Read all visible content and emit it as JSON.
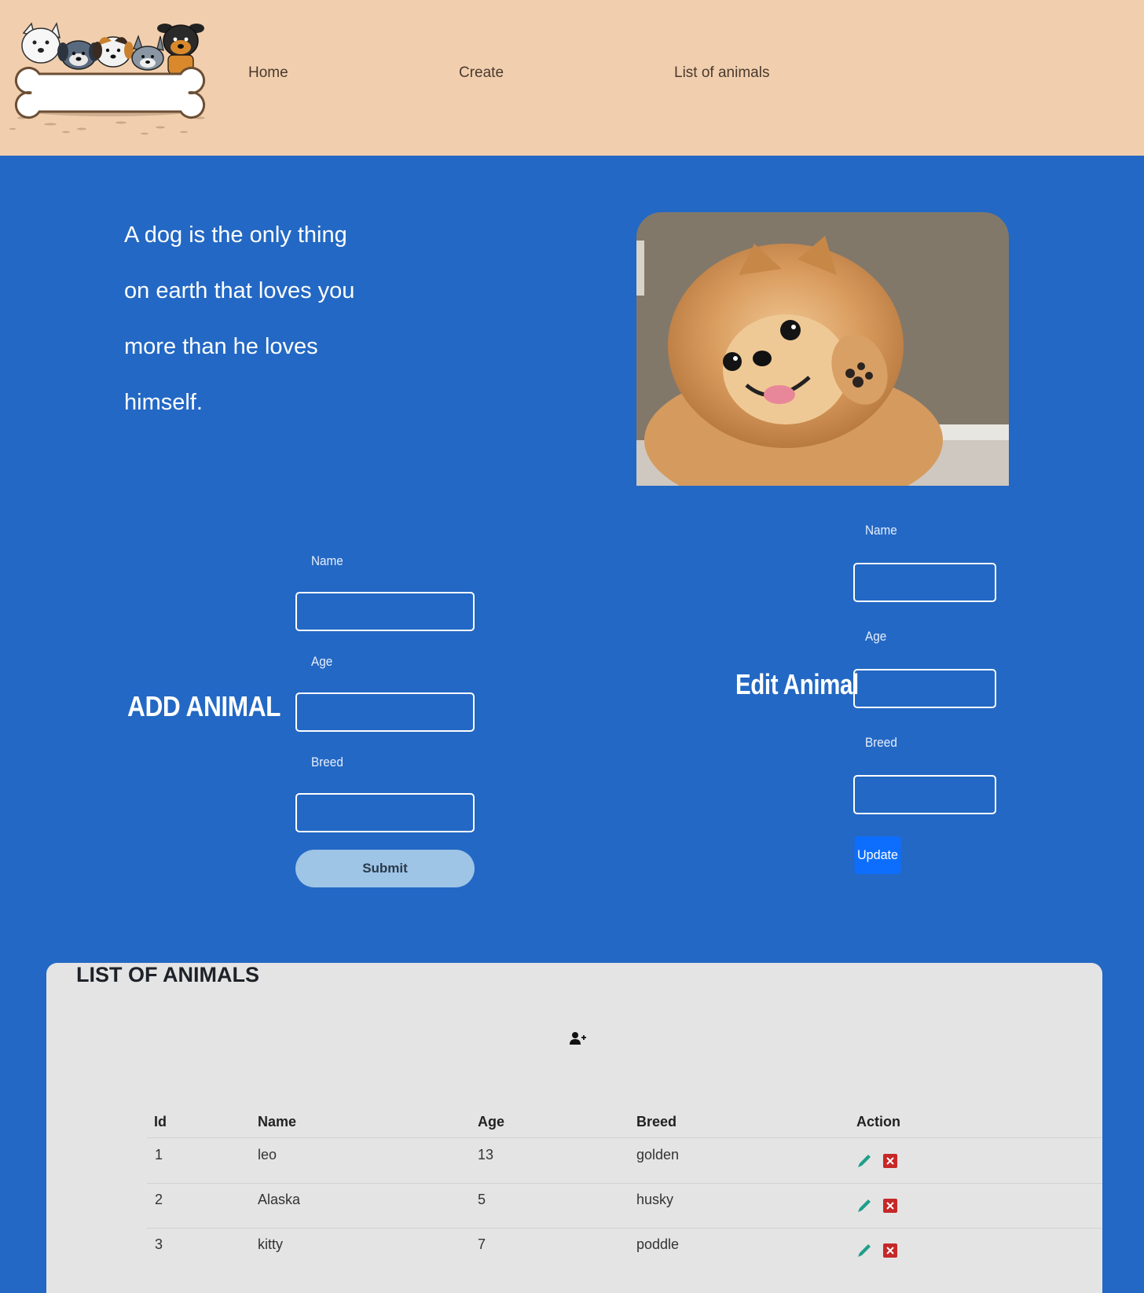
{
  "nav": {
    "links": [
      "Home",
      "Create",
      "List of animals"
    ]
  },
  "hero": {
    "quote_lines": [
      "A dog is the only thing",
      "on earth that loves you",
      "more than he loves",
      "himself."
    ]
  },
  "add_form": {
    "title": "ADD ANIMAL",
    "name_label": "Name",
    "age_label": "Age",
    "breed_label": "Breed",
    "name_value": "",
    "age_value": "",
    "breed_value": "",
    "submit_label": "Submit"
  },
  "edit_form": {
    "title": "Edit Animal",
    "name_label": "Name",
    "age_label": "Age",
    "breed_label": "Breed",
    "name_value": "",
    "age_value": "",
    "breed_value": "",
    "update_label": "Update"
  },
  "list": {
    "title": "LIST OF ANIMALS",
    "add_icon": "add-user-icon",
    "columns": [
      "Id",
      "Name",
      "Age",
      "Breed",
      "Action"
    ],
    "rows": [
      {
        "id": "1",
        "name": "leo",
        "age": "13",
        "breed": "golden"
      },
      {
        "id": "2",
        "name": "Alaska",
        "age": "5",
        "breed": "husky"
      },
      {
        "id": "3",
        "name": "kitty",
        "age": "7",
        "breed": "poddle"
      }
    ],
    "action_icons": [
      "pencil-icon",
      "delete-x-icon"
    ]
  },
  "colors": {
    "header_bg": "#f1cfae",
    "page_bg": "#2368c4",
    "panel_bg": "#e4e4e4",
    "submit_bg": "#9ec4e6",
    "update_bg": "#0d6efd",
    "edit_icon": "#1f9e8a",
    "delete_icon": "#c62828"
  }
}
